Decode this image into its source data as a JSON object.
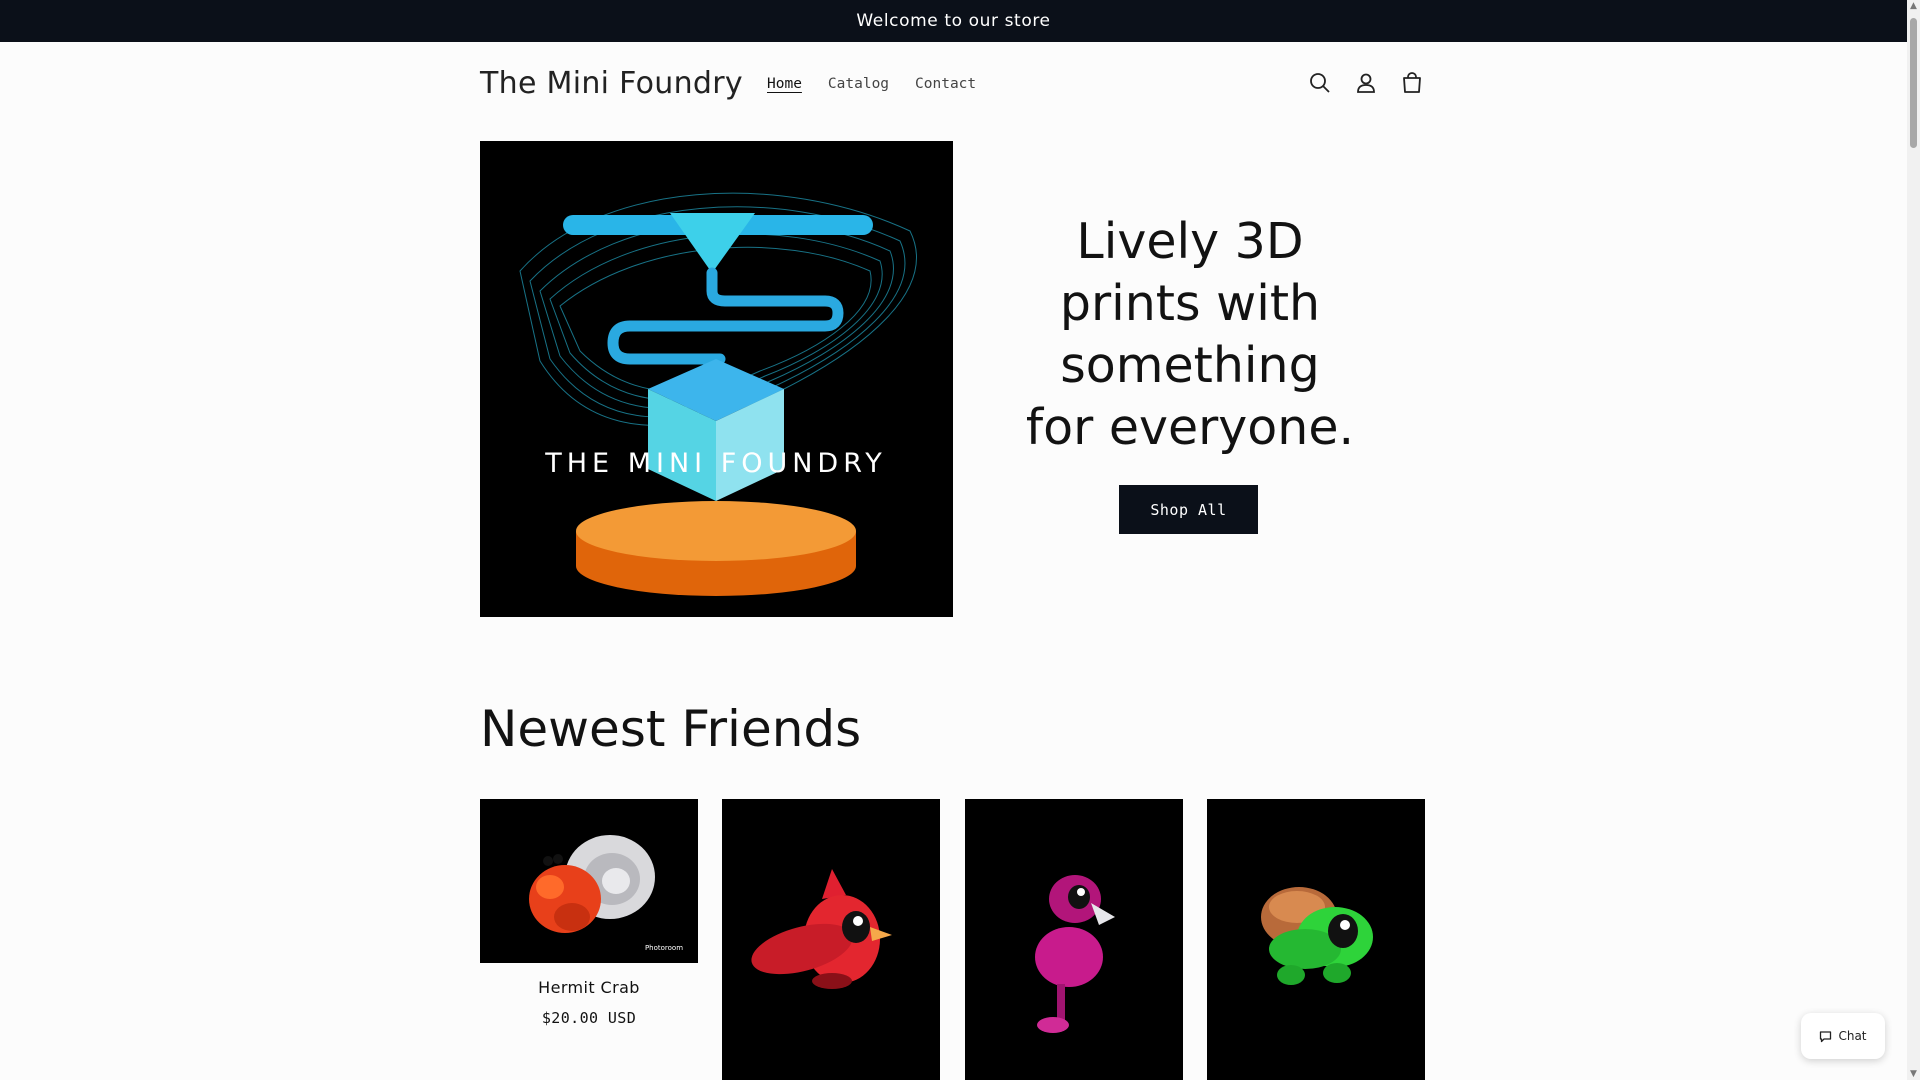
{
  "announcement": "Welcome to our store",
  "header": {
    "logo": "The Mini Foundry",
    "nav": [
      {
        "label": "Home",
        "active": true
      },
      {
        "label": "Catalog",
        "active": false
      },
      {
        "label": "Contact",
        "active": false
      }
    ],
    "icons": [
      "search-icon",
      "account-icon",
      "cart-icon"
    ]
  },
  "hero": {
    "image_text": "THE MINI FOUNDRY",
    "heading_lines": [
      "Lively 3D",
      "prints with",
      "something",
      "for everyone."
    ],
    "button": "Shop All"
  },
  "section": {
    "title": "Newest Friends",
    "products": [
      {
        "name": "Hermit Crab",
        "price": "$20.00 USD",
        "image_badge": "Photoroom",
        "icon": "hermit-crab-image"
      },
      {
        "name": "",
        "price": "",
        "icon": "cardinal-bird-image"
      },
      {
        "name": "",
        "price": "",
        "icon": "flamingo-image"
      },
      {
        "name": "",
        "price": "",
        "icon": "turtle-image"
      }
    ]
  },
  "chat": {
    "label": "Chat"
  },
  "colors": {
    "announcement_bg": "#0b1019",
    "button_bg": "#0b1019",
    "page_bg": "#fcfcfc",
    "accent_blue": "#2bb6e6",
    "accent_orange": "#f08a24"
  }
}
